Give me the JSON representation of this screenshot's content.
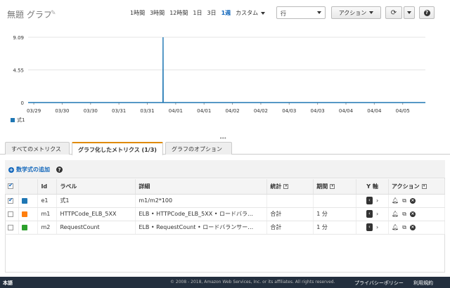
{
  "header": {
    "title": "無題 グラフ",
    "ranges": [
      "1時間",
      "3時間",
      "12時間",
      "1日",
      "3日",
      "1週"
    ],
    "active_range": "1週",
    "custom_label": "カスタム",
    "view_select": "行",
    "action_label": "アクション"
  },
  "chart_data": {
    "type": "line",
    "x_tick_labels": [
      "03/29",
      "03/30",
      "03/30",
      "03/31",
      "03/31",
      "04/01",
      "04/01",
      "04/02",
      "04/02",
      "04/03",
      "04/03",
      "04/04",
      "04/04",
      "04/05"
    ],
    "y_tick_labels": [
      "9.09",
      "4.55",
      "0"
    ],
    "ylim": [
      0,
      9.09
    ],
    "series": [
      {
        "name": "式1",
        "color": "#1f77b4",
        "x": [
          0,
          4.75,
          4.755,
          4.76,
          14
        ],
        "y": [
          0,
          0,
          9.09,
          0,
          0
        ]
      }
    ],
    "grid": true,
    "legend_position": "bottom-left"
  },
  "tabs": [
    {
      "label": "すべてのメトリクス"
    },
    {
      "label": "グラフ化したメトリクス (1/3)"
    },
    {
      "label": "グラフのオプション"
    }
  ],
  "add_math_label": "数学式の追加",
  "table": {
    "headers": {
      "id": "Id",
      "label": "ラベル",
      "details": "詳細",
      "stat": "統計",
      "period": "期間",
      "yaxis": "Y 軸",
      "actions": "アクション"
    },
    "rows": [
      {
        "checked": true,
        "color": "#1f77b4",
        "id": "e1",
        "label": "式1",
        "details": "m1/m2*100",
        "stat": "",
        "period": ""
      },
      {
        "checked": false,
        "color": "#ff7f0e",
        "id": "m1",
        "label": "HTTPCode_ELB_5XX",
        "details": "ELB • HTTPCode_ELB_5XX • ロードバラ…",
        "stat": "合計",
        "period": "1 分"
      },
      {
        "checked": false,
        "color": "#2ca02c",
        "id": "m2",
        "label": "RequestCount",
        "details": "ELB • RequestCount • ロードバランサー…",
        "stat": "合計",
        "period": "1 分"
      }
    ]
  },
  "footer": {
    "language": "本語",
    "copyright": "© 2008 - 2018, Amazon Web Services, Inc. or its affiliates. All rights reserved.",
    "privacy": "プライバシーポリシー",
    "terms": "利用規約"
  }
}
